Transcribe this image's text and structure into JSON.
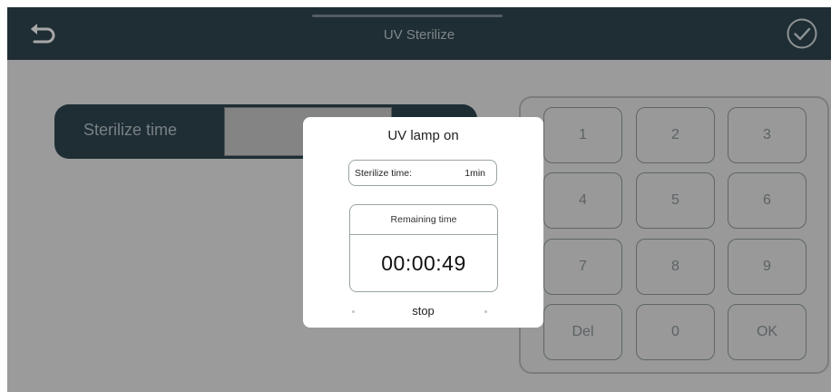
{
  "header": {
    "title": "UV Sterilize",
    "back_icon": "back-arrow-icon",
    "confirm_icon": "check-circle-icon"
  },
  "sterilize": {
    "label": "Sterilize time",
    "value": ""
  },
  "keypad": {
    "keys": [
      "1",
      "2",
      "3",
      "4",
      "5",
      "6",
      "7",
      "8",
      "9",
      "Del",
      "0",
      "OK"
    ]
  },
  "dialog": {
    "title": "UV lamp on",
    "sterilize_time_label": "Sterilize time:",
    "sterilize_time_value": "1min",
    "remaining_label": "Remaining time",
    "remaining_time": "00:00:49",
    "stop_label": "stop"
  },
  "colors": {
    "header_bg": "#304750",
    "panel_bg": "#e9e9e9",
    "modal_bg": "#ffffff"
  }
}
